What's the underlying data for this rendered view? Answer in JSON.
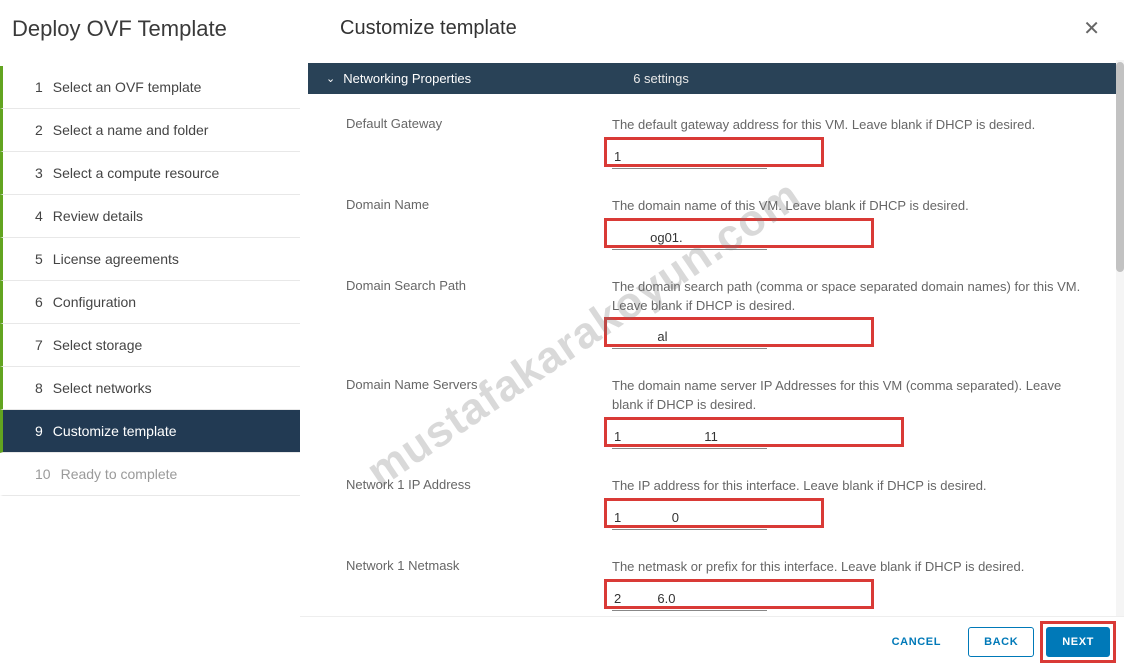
{
  "wizard": {
    "title": "Deploy OVF Template",
    "steps": [
      {
        "num": "1",
        "label": "Select an OVF template",
        "state": "completed"
      },
      {
        "num": "2",
        "label": "Select a name and folder",
        "state": "completed"
      },
      {
        "num": "3",
        "label": "Select a compute resource",
        "state": "completed"
      },
      {
        "num": "4",
        "label": "Review details",
        "state": "completed"
      },
      {
        "num": "5",
        "label": "License agreements",
        "state": "completed"
      },
      {
        "num": "6",
        "label": "Configuration",
        "state": "completed"
      },
      {
        "num": "7",
        "label": "Select storage",
        "state": "completed"
      },
      {
        "num": "8",
        "label": "Select networks",
        "state": "completed"
      },
      {
        "num": "9",
        "label": "Customize template",
        "state": "active"
      },
      {
        "num": "10",
        "label": "Ready to complete",
        "state": "pending"
      }
    ]
  },
  "main": {
    "title": "Customize template",
    "section": {
      "label": "Networking Properties",
      "count": "6 settings"
    },
    "fields": [
      {
        "label": "Default Gateway",
        "desc": "The default gateway address for this VM. Leave blank if DHCP is desired.",
        "value": "1"
      },
      {
        "label": "Domain Name",
        "desc": "The domain name of this VM. Leave blank if DHCP is desired.",
        "value": "          og01."
      },
      {
        "label": "Domain Search Path",
        "desc": "The domain search path (comma or space separated domain names) for this VM. Leave blank if DHCP is desired.",
        "value": "            al"
      },
      {
        "label": "Domain Name Servers",
        "desc": "The domain name server IP Addresses for this VM (comma separated). Leave blank if DHCP is desired.",
        "value": "1                       11"
      },
      {
        "label": "Network 1 IP Address",
        "desc": "The IP address for this interface. Leave blank if DHCP is desired.",
        "value": "1              0"
      },
      {
        "label": "Network 1 Netmask",
        "desc": "The netmask or prefix for this interface. Leave blank if DHCP is desired.",
        "value": "2          6.0"
      }
    ]
  },
  "footer": {
    "cancel": "CANCEL",
    "back": "BACK",
    "next": "NEXT"
  },
  "watermark": "mustafakarakoyun.com"
}
